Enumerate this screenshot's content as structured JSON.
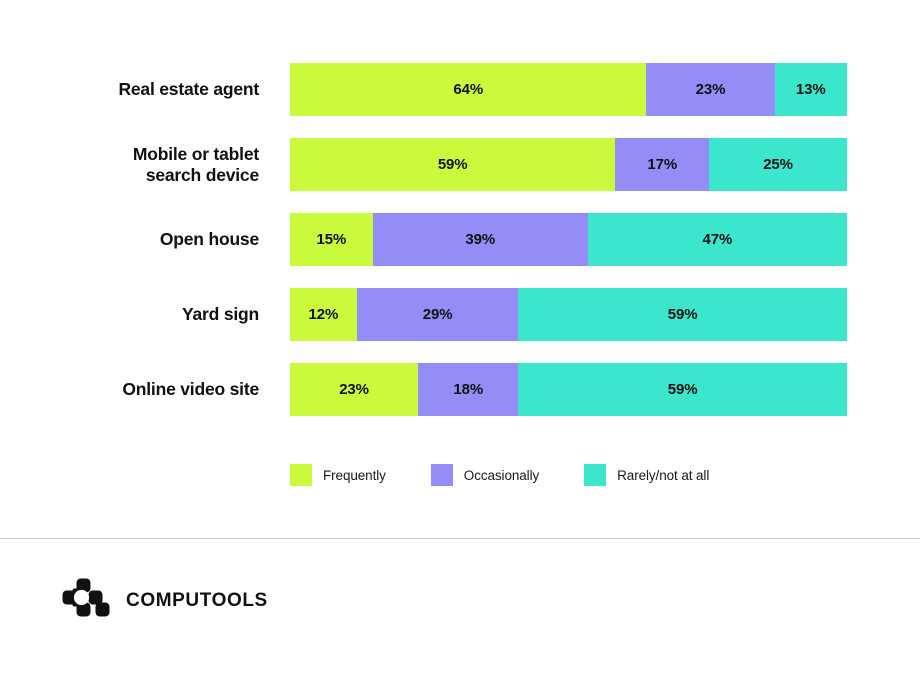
{
  "chart_data": {
    "type": "bar",
    "subtype": "stacked-horizontal-100",
    "title": "",
    "xlabel": "",
    "ylabel": "",
    "xlim": [
      0,
      100
    ],
    "grid": false,
    "legend_position": "bottom-left",
    "categories": [
      "Real estate agent",
      "Mobile or tablet search device",
      "Open house",
      "Yard sign",
      "Online video site"
    ],
    "series": [
      {
        "name": "Frequently",
        "color": "#C9FA3C",
        "values": [
          64,
          59,
          15,
          12,
          23
        ]
      },
      {
        "name": "Occasionally",
        "color": "#948DF8",
        "values": [
          23,
          17,
          39,
          29,
          18
        ]
      },
      {
        "name": "Rarely/not at all",
        "color": "#3CE6CD",
        "values": [
          13,
          25,
          47,
          59,
          59
        ]
      }
    ],
    "rows": [
      {
        "label": "Real estate agent",
        "label_lines": [
          "Real estate agent"
        ],
        "segments": [
          {
            "series": "Frequently",
            "value": 64,
            "value_label": "64%",
            "color": "#C9FA3C"
          },
          {
            "series": "Occasionally",
            "value": 23,
            "value_label": "23%",
            "color": "#948DF8"
          },
          {
            "series": "Rarely/not at all",
            "value": 13,
            "value_label": "13%",
            "color": "#3CE6CD"
          }
        ]
      },
      {
        "label": "Mobile or tablet search device",
        "label_lines": [
          "Mobile or tablet",
          "search device"
        ],
        "segments": [
          {
            "series": "Frequently",
            "value": 59,
            "value_label": "59%",
            "color": "#C9FA3C"
          },
          {
            "series": "Occasionally",
            "value": 17,
            "value_label": "17%",
            "color": "#948DF8"
          },
          {
            "series": "Rarely/not at all",
            "value": 25,
            "value_label": "25%",
            "color": "#3CE6CD"
          }
        ]
      },
      {
        "label": "Open house",
        "label_lines": [
          "Open house"
        ],
        "segments": [
          {
            "series": "Frequently",
            "value": 15,
            "value_label": "15%",
            "color": "#C9FA3C"
          },
          {
            "series": "Occasionally",
            "value": 39,
            "value_label": "39%",
            "color": "#948DF8"
          },
          {
            "series": "Rarely/not at all",
            "value": 47,
            "value_label": "47%",
            "color": "#3CE6CD"
          }
        ]
      },
      {
        "label": "Yard sign",
        "label_lines": [
          "Yard sign"
        ],
        "segments": [
          {
            "series": "Frequently",
            "value": 12,
            "value_label": "12%",
            "color": "#C9FA3C"
          },
          {
            "series": "Occasionally",
            "value": 29,
            "value_label": "29%",
            "color": "#948DF8"
          },
          {
            "series": "Rarely/not at all",
            "value": 59,
            "value_label": "59%",
            "color": "#3CE6CD"
          }
        ]
      },
      {
        "label": "Online video site",
        "label_lines": [
          "Online video site"
        ],
        "segments": [
          {
            "series": "Frequently",
            "value": 23,
            "value_label": "23%",
            "color": "#C9FA3C"
          },
          {
            "series": "Occasionally",
            "value": 18,
            "value_label": "18%",
            "color": "#948DF8"
          },
          {
            "series": "Rarely/not at all",
            "value": 59,
            "value_label": "59%",
            "color": "#3CE6CD"
          }
        ]
      }
    ]
  },
  "legend": [
    {
      "label": "Frequently",
      "color": "#C9FA3C"
    },
    {
      "label": "Occasionally",
      "color": "#948DF8"
    },
    {
      "label": "Rarely/not at all",
      "color": "#3CE6CD"
    }
  ],
  "footer": {
    "brand": "COMPUTOOLS",
    "logo_icon": "computools-blocks-logo"
  },
  "colors": {
    "frequently": "#C9FA3C",
    "occasionally": "#948DF8",
    "rarely": "#3CE6CD",
    "text": "#111111",
    "divider": "#c9c9c9",
    "background": "#ffffff"
  }
}
